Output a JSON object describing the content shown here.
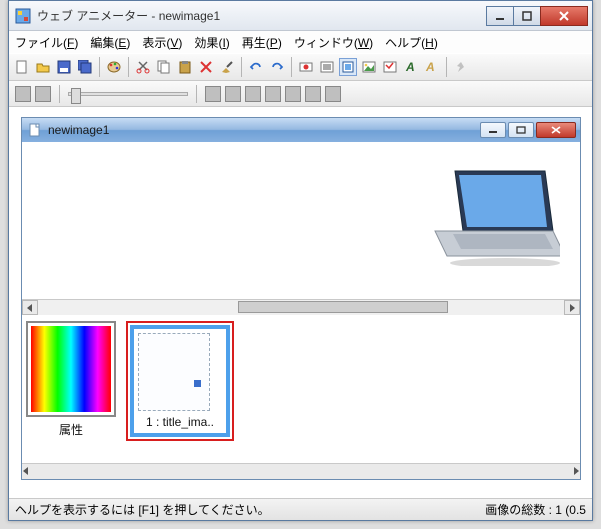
{
  "app": {
    "title": "ウェブ アニメーター - newimage1"
  },
  "menu": {
    "file": {
      "label": "ファイル",
      "key": "F"
    },
    "edit": {
      "label": "編集",
      "key": "E"
    },
    "view": {
      "label": "表示",
      "key": "V"
    },
    "effect": {
      "label": "効果",
      "key": "I"
    },
    "play": {
      "label": "再生",
      "key": "P"
    },
    "window": {
      "label": "ウィンドウ",
      "key": "W"
    },
    "help": {
      "label": "ヘルプ",
      "key": "H"
    }
  },
  "toolbar_icons": [
    "new",
    "open",
    "save",
    "save-all",
    "paint",
    "cut",
    "copy",
    "paste",
    "delete",
    "brush",
    "undo",
    "redo",
    "record",
    "list",
    "window-tile",
    "image",
    "fx",
    "text",
    "text-fx",
    "help"
  ],
  "child": {
    "title": "newimage1"
  },
  "thumbs": {
    "attr_label": "属性",
    "frame1_label": "1 : title_ima.."
  },
  "status": {
    "left": "ヘルプを表示するには [F1] を押してください。",
    "right": "画像の総数 : 1 (0.5"
  }
}
